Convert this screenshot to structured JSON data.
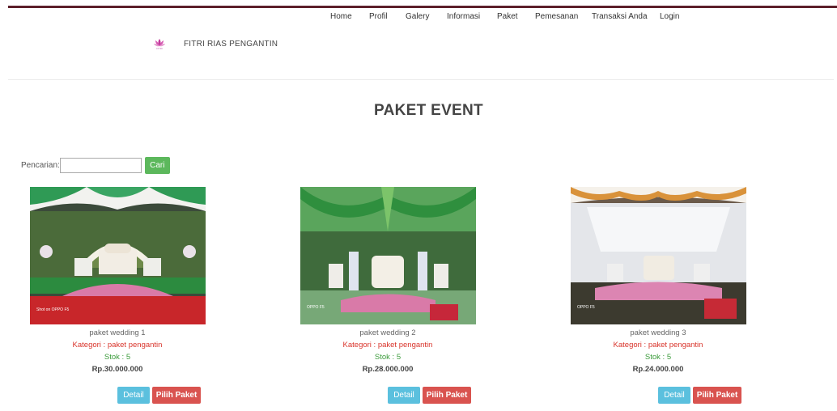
{
  "nav": {
    "items": [
      {
        "label": "Home"
      },
      {
        "label": "Profil"
      },
      {
        "label": "Galery"
      },
      {
        "label": "Informasi"
      },
      {
        "label": "Paket"
      },
      {
        "label": "Pemesanan"
      },
      {
        "label": "Transaksi Anda"
      },
      {
        "label": "Login"
      }
    ]
  },
  "brand": {
    "name": "FITRI RIAS PENGANTIN",
    "logo_icon": "lotus-logo-icon",
    "logo_text": "FITRI"
  },
  "page": {
    "title": "PAKET EVENT"
  },
  "search": {
    "label": "Pencarian:",
    "value": "",
    "button": "Cari"
  },
  "products": [
    {
      "name": "paket wedding 1",
      "kategori": "Kategori : paket pengantin",
      "stok": "Stok : 5",
      "price": "Rp.30.000.000",
      "detail": "Detail",
      "pilih": "Pilih Paket",
      "photo_caption": "Shot on OPPO F5"
    },
    {
      "name": "paket wedding 2",
      "kategori": "Kategori : paket pengantin",
      "stok": "Stok : 5",
      "price": "Rp.28.000.000",
      "detail": "Detail",
      "pilih": "Pilih Paket",
      "photo_caption": "OPPO F5"
    },
    {
      "name": "paket wedding 3",
      "kategori": "Kategori : paket pengantin",
      "stok": "Stok : 5",
      "price": "Rp.24.000.000",
      "detail": "Detail",
      "pilih": "Pilih Paket",
      "photo_caption": "OPPO F5"
    }
  ],
  "colors": {
    "topbar": "#5c1f2a",
    "search_button": "#5cb85c",
    "detail_button": "#5bc0de",
    "pilih_button": "#d9534f",
    "kategori_text": "#d9342b",
    "stok_text": "#3c9c3c"
  }
}
